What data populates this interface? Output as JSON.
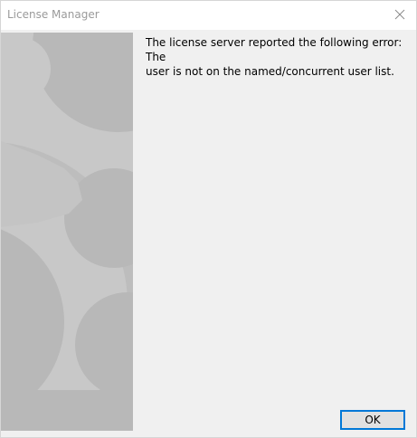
{
  "window": {
    "title": "License Manager"
  },
  "dialog": {
    "message": "The license server reported the following error: The\nuser is not on the named/concurrent user list.",
    "ok_label": "OK"
  },
  "icons": {
    "close": "close-icon",
    "decoration": "gear-icon"
  },
  "colors": {
    "accent": "#0078d7",
    "panel": "#f0f0f0",
    "art_light": "#c8c8c8",
    "art_dark": "#b8b8b8"
  }
}
